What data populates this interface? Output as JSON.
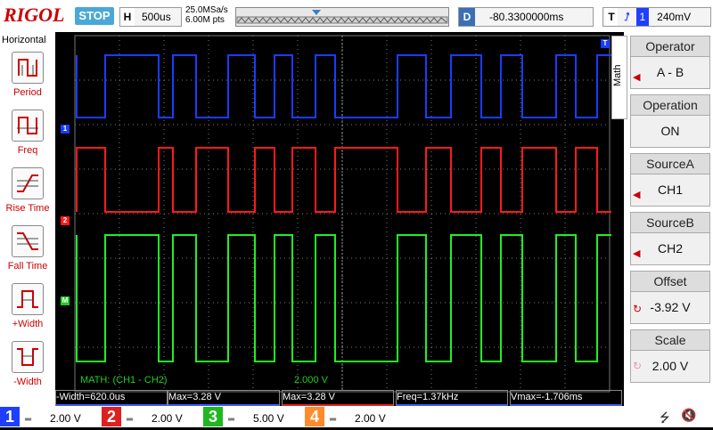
{
  "brand": "RIGOL",
  "status": "STOP",
  "horizontal": {
    "key": "H",
    "timebase": "500us",
    "sample_rate": "25.0MSa/s",
    "mem_depth": "6.00M pts"
  },
  "delay": {
    "key": "D",
    "value": "-80.3300000ms"
  },
  "trigger": {
    "key": "T",
    "source": "1",
    "level": "240mV"
  },
  "left_menu": {
    "title": "Horizontal",
    "items": [
      {
        "label": "Period",
        "icon": "period-icon"
      },
      {
        "label": "Freq",
        "icon": "freq-icon"
      },
      {
        "label": "Rise Time",
        "icon": "rise-time-icon"
      },
      {
        "label": "Fall Time",
        "icon": "fall-time-icon"
      },
      {
        "label": "+Width",
        "icon": "pos-width-icon"
      },
      {
        "label": "-Width",
        "icon": "neg-width-icon"
      }
    ]
  },
  "right_menu": {
    "tab": "Math",
    "items": [
      {
        "title": "Operator",
        "value": "A - B"
      },
      {
        "title": "Operation",
        "value": "ON"
      },
      {
        "title": "SourceA",
        "value": "CH1"
      },
      {
        "title": "SourceB",
        "value": "CH2"
      },
      {
        "title": "Offset",
        "value": "-3.92 V"
      },
      {
        "title": "Scale",
        "value": "2.00 V"
      }
    ]
  },
  "math_trace": {
    "label": "MATH: (CH1 - CH2)",
    "scale": "2.000 V"
  },
  "markers": {
    "ch1": "1",
    "ch2": "2",
    "math": "M",
    "trig": "T"
  },
  "measurements": [
    {
      "text": "-Width=620.0us",
      "color": "#3b5bff"
    },
    {
      "text": "Max=3.28 V",
      "color": "#3b5bff"
    },
    {
      "text": "Max=3.28 V",
      "color": "#e02020"
    },
    {
      "text": "Freq=1.37kHz",
      "color": "#3b5bff"
    },
    {
      "text": "Vmax=-1.706ms",
      "color": "#3b5bff"
    }
  ],
  "channels": [
    {
      "num": "1",
      "scale": "2.00 V",
      "color": "#1f3fff"
    },
    {
      "num": "2",
      "scale": "2.00 V",
      "color": "#e02020"
    },
    {
      "num": "3",
      "scale": "5.00 V",
      "color": "#1fb81f"
    },
    {
      "num": "4",
      "scale": "2.00 V",
      "color": "#ff8a2a"
    }
  ],
  "colors": {
    "ch1": "#1a3cff",
    "ch2": "#ff1a1a",
    "math": "#22ee22",
    "grid": "#7a7a7a",
    "accent": "#c00000"
  }
}
